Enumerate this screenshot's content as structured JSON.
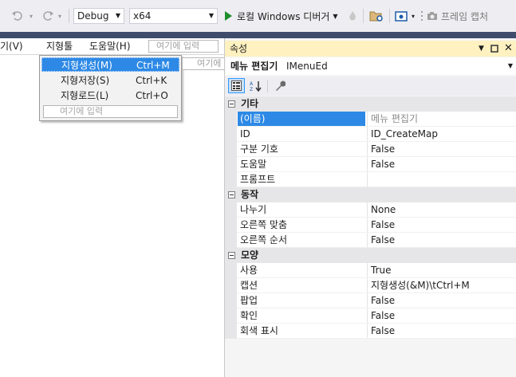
{
  "toolbar": {
    "config_value": "Debug",
    "platform_value": "x64",
    "run_label": "로컬 Windows 디버거",
    "frame_capture_label": "프레임 캡처"
  },
  "menubar": {
    "items": [
      {
        "label": "기(V)"
      },
      {
        "label": "지형툴"
      },
      {
        "label": "도움말(H)"
      }
    ],
    "type_here": "여기에 입력",
    "type_here_sub": "여기에"
  },
  "dropdown": {
    "items": [
      {
        "label": "지형생성(M)",
        "shortcut": "Ctrl+M"
      },
      {
        "label": "지형저장(S)",
        "shortcut": "Ctrl+K"
      },
      {
        "label": "지형로드(L)",
        "shortcut": "Ctrl+O"
      }
    ],
    "type_here": "여기에 입력"
  },
  "properties": {
    "title": "속성",
    "object_name": "메뉴 편집기",
    "object_type": "IMenuEd",
    "categories": [
      {
        "name": "기타",
        "rows": [
          {
            "name": "(이름)",
            "value": "메뉴 편집기"
          },
          {
            "name": "ID",
            "value": "ID_CreateMap"
          },
          {
            "name": "구분 기호",
            "value": "False"
          },
          {
            "name": "도움말",
            "value": "False"
          },
          {
            "name": "프롬프트",
            "value": ""
          }
        ]
      },
      {
        "name": "동작",
        "rows": [
          {
            "name": "나누기",
            "value": "None"
          },
          {
            "name": "오른쪽 맞춤",
            "value": "False"
          },
          {
            "name": "오른쪽 순서",
            "value": "False"
          }
        ]
      },
      {
        "name": "모양",
        "rows": [
          {
            "name": "사용",
            "value": "True"
          },
          {
            "name": "캡션",
            "value": "지형생성(&M)\\tCtrl+M"
          },
          {
            "name": "팝업",
            "value": "False"
          },
          {
            "name": "확인",
            "value": "False"
          },
          {
            "name": "회색 표시",
            "value": "False"
          }
        ]
      }
    ]
  },
  "colors": {
    "accent": "#2d89e5",
    "panel_title": "#fff1c0",
    "run_green": "#1e8c2c"
  }
}
